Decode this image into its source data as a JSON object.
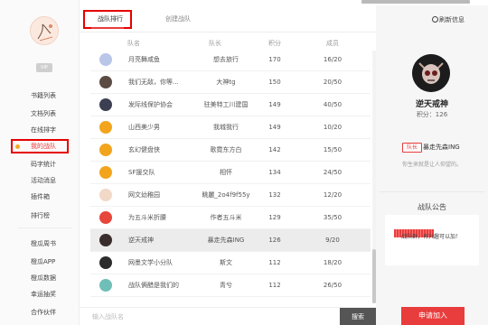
{
  "sidebar": {
    "vip_label": "VIP",
    "items": [
      {
        "label": "书籍列表"
      },
      {
        "label": "文档列表"
      },
      {
        "label": "在线排字"
      },
      {
        "label": "我的战队"
      },
      {
        "label": "码字统计"
      },
      {
        "label": "活动消息"
      },
      {
        "label": "插件箱"
      },
      {
        "label": "排行榜"
      },
      {
        "label": "橙瓜周书"
      },
      {
        "label": "橙瓜APP"
      },
      {
        "label": "橙瓜数据"
      },
      {
        "label": "幸运抽奖"
      },
      {
        "label": "合作伙伴"
      }
    ],
    "active_index": 3
  },
  "tabs": [
    {
      "label": "战队排行"
    },
    {
      "label": "创建战队"
    }
  ],
  "table": {
    "columns": [
      "队名",
      "队长",
      "积分",
      "成员"
    ],
    "rows": [
      {
        "name": "月亮舞咸鱼",
        "leader": "想去旅行",
        "points": "170",
        "members": "16/20",
        "logo_color": "#b9c6e8"
      },
      {
        "name": "我们无敌，你等...",
        "leader": "大神tg",
        "points": "150",
        "members": "20/50",
        "logo_color": "#5a4b43"
      },
      {
        "name": "发际线保护协会",
        "leader": "驻美特工川建国",
        "points": "149",
        "members": "40/50",
        "logo_color": "#3c3f52"
      },
      {
        "name": "山西美少男",
        "leader": "我城我行",
        "points": "149",
        "members": "10/20",
        "logo_color": "#f2a41d"
      },
      {
        "name": "玄幻健盘侠",
        "leader": "歌霓东方白",
        "points": "142",
        "members": "15/50",
        "logo_color": "#f2a41d"
      },
      {
        "name": "SF援交队",
        "leader": "相怀",
        "points": "134",
        "members": "24/50",
        "logo_color": "#f2a41d"
      },
      {
        "name": "网文幼稚园",
        "leader": "眺麗_2o4f9f55y",
        "points": "132",
        "members": "12/20",
        "logo_color": "#f1d8c7"
      },
      {
        "name": "为五斗米折腰",
        "leader": "作者五斗米",
        "points": "129",
        "members": "35/50",
        "logo_color": "#e7463b"
      },
      {
        "name": "逆天戒神",
        "leader": "暴走先森ING",
        "points": "126",
        "members": "9/20",
        "logo_color": "#3a2d2d"
      },
      {
        "name": "网墨文学小分队",
        "leader": "斯文",
        "points": "112",
        "members": "18/20",
        "logo_color": "#2c2c2c"
      },
      {
        "name": "战队俩醋是我们的",
        "leader": "青兮",
        "points": "112",
        "members": "26/50",
        "logo_color": "#6fbfb8"
      }
    ],
    "highlight_index": 8
  },
  "search": {
    "placeholder": "输入战队名",
    "button_label": "搜索"
  },
  "panel": {
    "refresh_label": "刷新信息",
    "clan_name": "逆天戒神",
    "points_text": "积分：126",
    "leader_tag": "队长",
    "leader_name": "暴走先森ING",
    "description": "你生来就是让人仰望的。",
    "notice_title": "战队公告",
    "notice_text": "战队群，有兴趣可以加！",
    "apply_label": "申请加入"
  },
  "colors": {
    "accent": "#e93c3c",
    "highlight_box": "#e60000"
  }
}
